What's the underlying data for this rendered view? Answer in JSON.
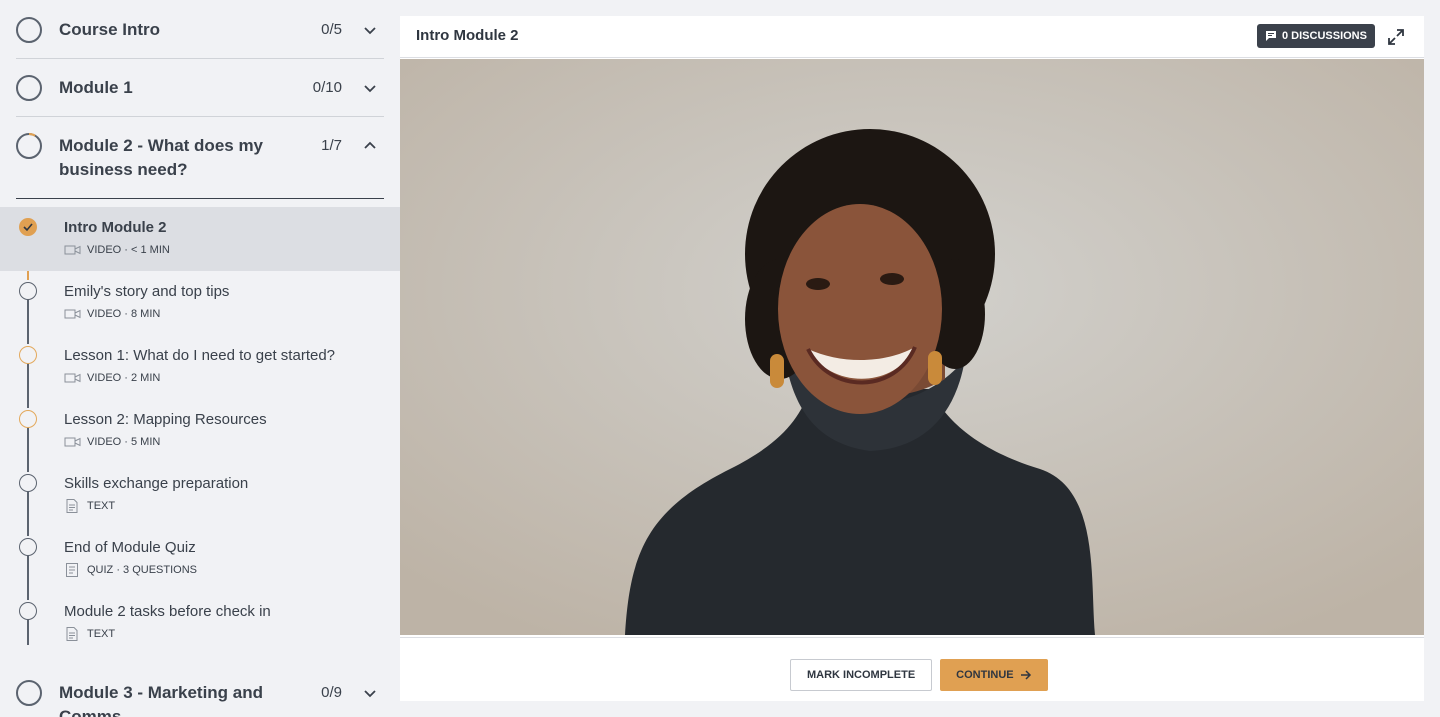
{
  "colors": {
    "accent": "#e0a052",
    "dark": "#3b414b",
    "sidebar_bg": "#f1f2f5"
  },
  "sidebar": {
    "modules": [
      {
        "title": "Course Intro",
        "count": "0/5",
        "icon": "chevron-down-icon"
      },
      {
        "title": "Module 1",
        "count": "0/10",
        "icon": "chevron-down-icon"
      },
      {
        "title_line1": "Module 2 - What does my",
        "title_line2": "business need?",
        "count": "1/7",
        "icon": "chevron-up-icon"
      },
      {
        "title_line1": "Module 3 - Marketing and",
        "title_line2": "Comms",
        "count": "0/9",
        "icon": "chevron-down-icon"
      }
    ],
    "lessons": [
      {
        "title": "Intro Module 2",
        "meta": "VIDEO · < 1 MIN",
        "icon": "video-icon",
        "status": "complete"
      },
      {
        "title": "Emily's story and top tips",
        "meta": "VIDEO · 8 MIN",
        "icon": "video-icon",
        "status": "not-started"
      },
      {
        "title": "Lesson 1: What do I need to get started?",
        "meta": "VIDEO · 2 MIN",
        "icon": "video-icon",
        "status": "in-progress"
      },
      {
        "title": "Lesson 2: Mapping Resources",
        "meta": "VIDEO · 5 MIN",
        "icon": "video-icon",
        "status": "in-progress"
      },
      {
        "title": "Skills exchange preparation",
        "meta": "TEXT",
        "icon": "text-doc-icon",
        "status": "not-started"
      },
      {
        "title": "End of Module Quiz",
        "meta": "QUIZ · 3 QUESTIONS",
        "icon": "quiz-icon",
        "status": "not-started"
      },
      {
        "title": "Module 2 tasks before check in",
        "meta": "TEXT",
        "icon": "text-doc-icon",
        "status": "not-started"
      }
    ]
  },
  "main": {
    "title": "Intro Module 2",
    "discussions_label": "0 DISCUSSIONS",
    "mark_incomplete_label": "MARK INCOMPLETE",
    "continue_label": "CONTINUE"
  }
}
